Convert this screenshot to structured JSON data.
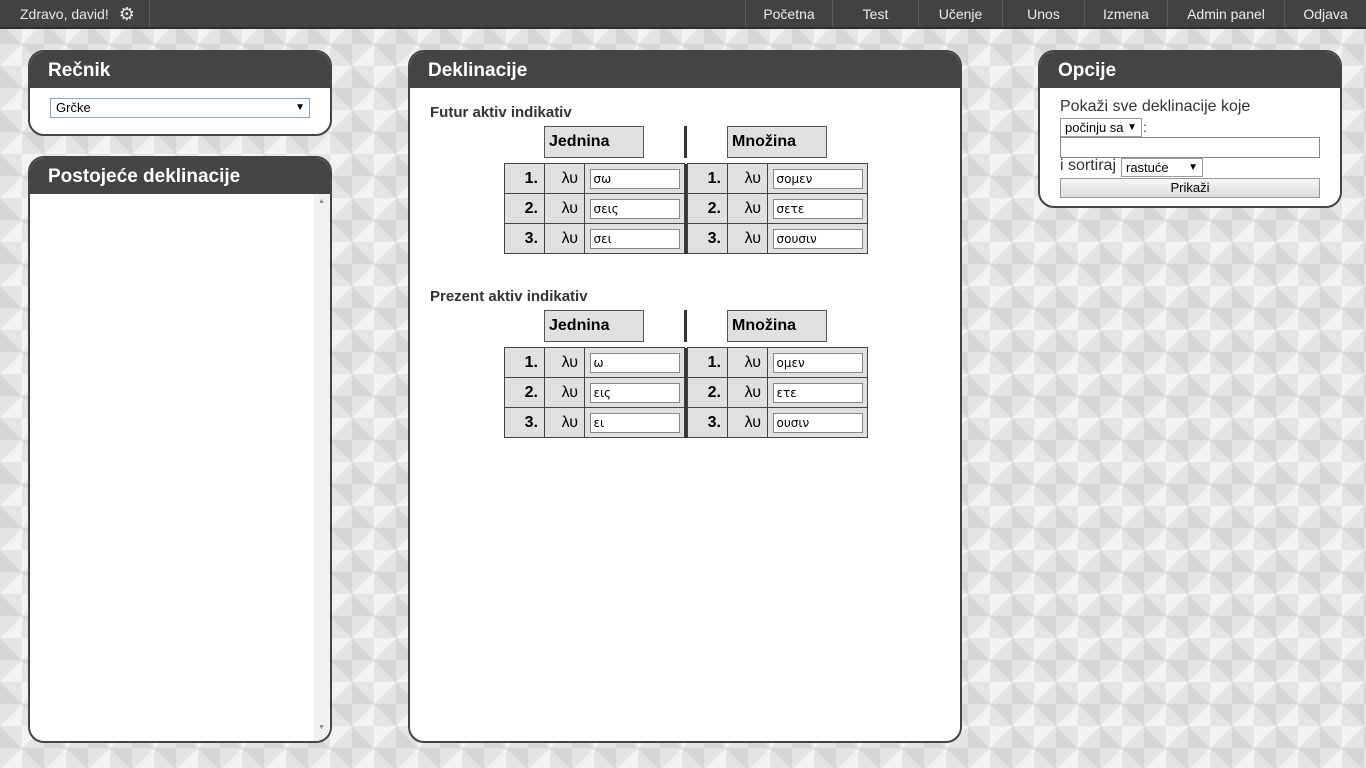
{
  "topbar": {
    "greeting": "Zdravo, david!",
    "nav": [
      "Početna",
      "Test",
      "Učenje",
      "Unos",
      "Izmena",
      "Admin panel",
      "Odjava"
    ]
  },
  "recnik": {
    "title": "Rečnik",
    "selected": "Grčke"
  },
  "postojece": {
    "title": "Postojeće deklinacije"
  },
  "deklinacije": {
    "title": "Deklinacije",
    "singular_label": "Jednina",
    "plural_label": "Množina",
    "groups": [
      {
        "title": "Futur aktiv indikativ",
        "rows": [
          {
            "num": "1.",
            "stem": "λυ",
            "sg": "σω",
            "pl_num": "1.",
            "pl_stem": "λυ",
            "pl": "σομεν"
          },
          {
            "num": "2.",
            "stem": "λυ",
            "sg": "σεις",
            "pl_num": "2.",
            "pl_stem": "λυ",
            "pl": "σετε"
          },
          {
            "num": "3.",
            "stem": "λυ",
            "sg": "σει",
            "pl_num": "3.",
            "pl_stem": "λυ",
            "pl": "σουσιν"
          }
        ]
      },
      {
        "title": "Prezent aktiv indikativ",
        "rows": [
          {
            "num": "1.",
            "stem": "λυ",
            "sg": "ω",
            "pl_num": "1.",
            "pl_stem": "λυ",
            "pl": "ομεν"
          },
          {
            "num": "2.",
            "stem": "λυ",
            "sg": "εις",
            "pl_num": "2.",
            "pl_stem": "λυ",
            "pl": "ετε"
          },
          {
            "num": "3.",
            "stem": "λυ",
            "sg": "ει",
            "pl_num": "3.",
            "pl_stem": "λυ",
            "pl": "ουσιν"
          }
        ]
      }
    ]
  },
  "opcije": {
    "title": "Opcije",
    "show_all_text": "Pokaži sve deklinacije koje",
    "match_select": "počinju sa",
    "colon": ":",
    "sort_label": "i sortiraj",
    "sort_select": "rastuće",
    "button": "Prikaži"
  }
}
